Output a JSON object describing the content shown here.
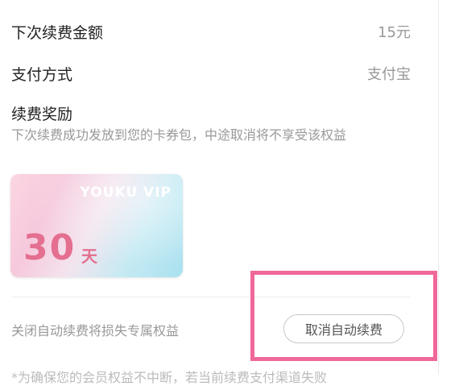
{
  "rows": {
    "amount": {
      "label": "下次续费金额",
      "value": "15元"
    },
    "method": {
      "label": "支付方式",
      "value": "支付宝"
    }
  },
  "reward": {
    "title": "续费奖励",
    "description": "下次续费成功发放到您的卡券包，中途取消将不享受该权益",
    "card": {
      "logo": "YOUKU VIP",
      "days": "30",
      "unit": "天"
    }
  },
  "cancel": {
    "hint": "关闭自动续费将损失专属权益",
    "button_label": "取消自动续费"
  },
  "footnote": "*为确保您的会员权益不中断，若当前续费支付渠道失败",
  "colors": {
    "highlight": "#f0689a",
    "card_text": "#e46f90"
  }
}
